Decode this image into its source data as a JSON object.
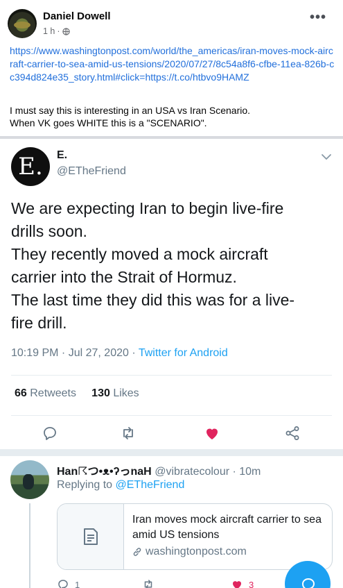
{
  "post": {
    "author": "Daniel Dowell",
    "time": "1 h",
    "meta_separator": "·",
    "more_label": "•••",
    "link": "https://www.washingtonpost.com/world/the_americas/iran-moves-mock-aircraft-carrier-to-sea-amid-us-tensions/2020/07/27/8c54a8f6-cfbe-11ea-826b-cc394d824e35_story.html#click=https://t.co/htbvo9HAMZ",
    "text_lines": [
      "I must say this is interesting in an USA vs Iran Scenario.",
      "When VK goes WHITE this is a \"SCENARIO\"."
    ]
  },
  "tweet": {
    "avatar_letter": "E.",
    "name": "E.",
    "handle": "@ETheFriend",
    "body_lines": [
      "We are expecting Iran to begin live-fire",
      "drills soon.",
      "They recently moved a mock aircraft",
      "carrier into the Strait of Hormuz.",
      "The last time they did this was for a live-",
      "fire drill."
    ],
    "timestamp": "10:19 PM · Jul 27, 2020 · ",
    "source": "Twitter for Android",
    "retweets_count": "66",
    "retweets_label": " Retweets",
    "likes_count": "130",
    "likes_label": " Likes",
    "actions": [
      "reply-icon",
      "retweet-icon",
      "heart-icon",
      "share-icon"
    ],
    "liked_color": "#e0245e"
  },
  "reply": {
    "name": "Han☈つ•ᴥ•ʔっnaH",
    "handle": " @vibratecolour · 10m",
    "replying_prefix": "Replying to ",
    "replying_to": "@ETheFriend",
    "card_title": "Iran moves mock aircraft carrier to sea amid US tensions",
    "card_domain": "washingtonpost.com",
    "reply_count": "1",
    "like_count": "3"
  },
  "colors": {
    "facebook_link": "#216fdb",
    "twitter_blue": "#1da1f2",
    "secondary_text": "#657786"
  }
}
